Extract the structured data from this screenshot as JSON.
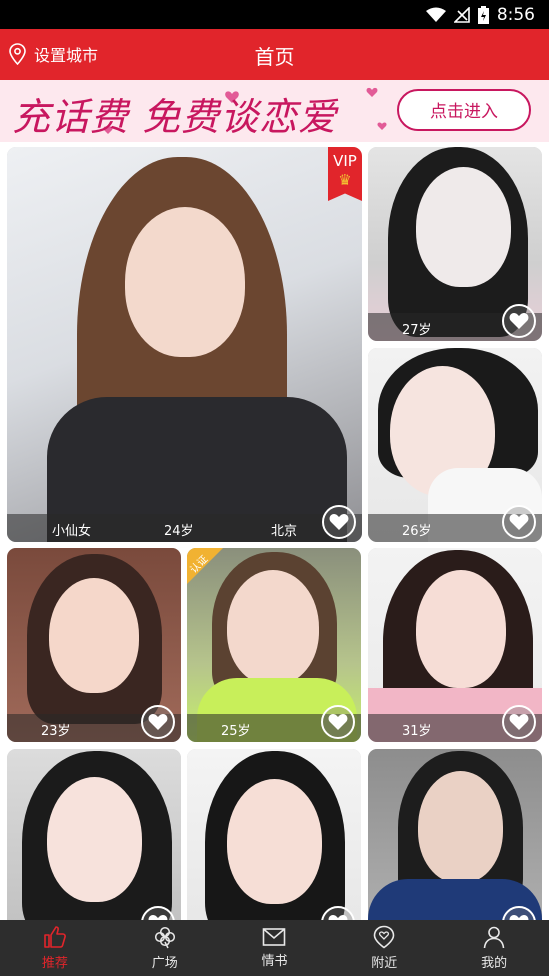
{
  "status_bar": {
    "time": "8:56"
  },
  "header": {
    "city_label": "设置城市",
    "title": "首页"
  },
  "banner": {
    "slogan": "充话费 免费谈恋爱",
    "enter_label": "点击进入"
  },
  "cards": [
    {
      "name": "小仙女",
      "age": "24岁",
      "city": "北京",
      "vip_label": "VIP"
    },
    {
      "age": "27岁"
    },
    {
      "age": "26岁"
    },
    {
      "age": "23岁"
    },
    {
      "age": "25岁",
      "badge": "认证"
    },
    {
      "age": "31岁"
    },
    {
      "age": ""
    },
    {
      "age": ""
    },
    {
      "age": ""
    }
  ],
  "tabs": [
    {
      "label": "推荐",
      "icon": "thumbs-up-icon",
      "active": true
    },
    {
      "label": "广场",
      "icon": "clover-icon",
      "active": false
    },
    {
      "label": "情书",
      "icon": "envelope-icon",
      "active": false
    },
    {
      "label": "附近",
      "icon": "location-pin-icon",
      "active": false
    },
    {
      "label": "我的",
      "icon": "person-icon",
      "active": false
    }
  ],
  "colors": {
    "brand_red": "#e1252b",
    "banner_pink": "#c8175f",
    "tabbar_bg": "#2d2d2d"
  }
}
